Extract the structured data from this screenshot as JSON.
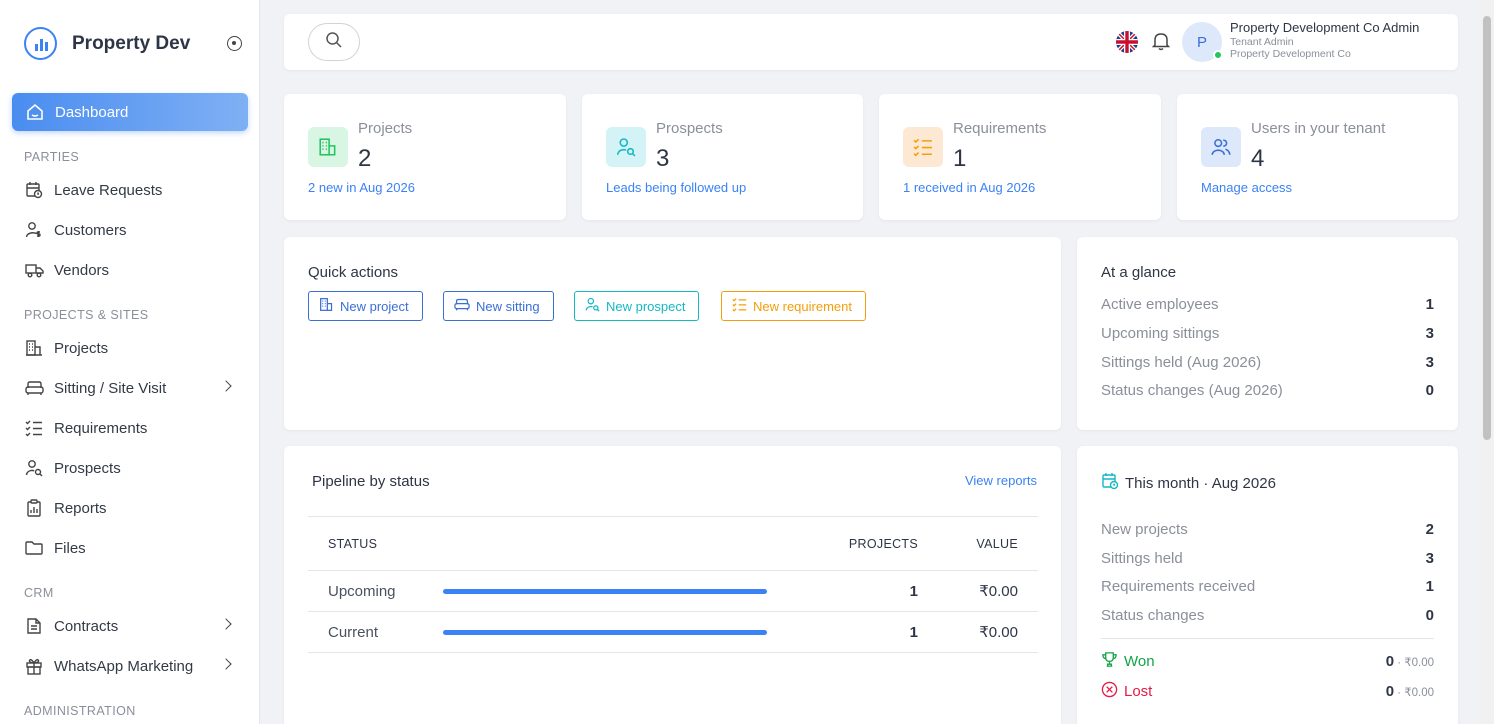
{
  "brand": {
    "name": "Property Dev"
  },
  "sidebar": {
    "dashboard_label": "Dashboard",
    "sections": {
      "parties": "PARTIES",
      "projects_sites": "PROJECTS & SITES",
      "crm": "CRM",
      "administration": "ADMINISTRATION"
    },
    "items": {
      "leave_requests": "Leave Requests",
      "customers": "Customers",
      "vendors": "Vendors",
      "projects": "Projects",
      "sitting": "Sitting / Site Visit",
      "requirements": "Requirements",
      "prospects": "Prospects",
      "reports": "Reports",
      "files": "Files",
      "contracts": "Contracts",
      "whatsapp": "WhatsApp Marketing"
    }
  },
  "header": {
    "user_initial": "P",
    "user_name": "Property Development Co Admin",
    "user_role": "Tenant Admin",
    "user_org": "Property Development Co"
  },
  "stats": {
    "projects": {
      "label": "Projects",
      "value": "2",
      "link": "2 new in Aug 2026"
    },
    "prospects": {
      "label": "Prospects",
      "value": "3",
      "link": "Leads being followed up"
    },
    "requirements": {
      "label": "Requirements",
      "value": "1",
      "link": "1 received in Aug 2026"
    },
    "users": {
      "label": "Users in your tenant",
      "value": "4",
      "link": "Manage access"
    }
  },
  "quick_actions": {
    "title": "Quick actions",
    "new_project": "New project",
    "new_sitting": "New sitting",
    "new_prospect": "New prospect",
    "new_requirement": "New requirement"
  },
  "glance": {
    "title": "At a glance",
    "rows": {
      "active_employees": {
        "label": "Active employees",
        "value": "1"
      },
      "upcoming_sittings": {
        "label": "Upcoming sittings",
        "value": "3"
      },
      "sittings_held": {
        "label": "Sittings held (Aug 2026)",
        "value": "3"
      },
      "status_changes": {
        "label": "Status changes (Aug 2026)",
        "value": "0"
      }
    }
  },
  "pipeline": {
    "title": "Pipeline by status",
    "link": "View reports",
    "headers": {
      "status": "STATUS",
      "projects": "PROJECTS",
      "value": "VALUE"
    },
    "rows": [
      {
        "status": "Upcoming",
        "projects": "1",
        "value": "₹0.00",
        "fill": 1.0
      },
      {
        "status": "Current",
        "projects": "1",
        "value": "₹0.00",
        "fill": 1.0
      }
    ]
  },
  "month": {
    "title": "This month · Aug 2026",
    "rows": {
      "new_projects": {
        "label": "New projects",
        "value": "2"
      },
      "sittings_held": {
        "label": "Sittings held",
        "value": "3"
      },
      "requirements_received": {
        "label": "Requirements received",
        "value": "1"
      },
      "status_changes": {
        "label": "Status changes",
        "value": "0"
      }
    },
    "won": {
      "label": "Won",
      "count": "0",
      "amount": " · ₹0.00"
    },
    "lost": {
      "label": "Lost",
      "count": "0",
      "amount": " · ₹0.00"
    }
  },
  "colors": {
    "accent": "#3b82f6",
    "green": "#22c55e",
    "teal": "#14b8c4",
    "orange": "#f59e0b",
    "won": "#16a34a",
    "lost": "#e11d48"
  }
}
